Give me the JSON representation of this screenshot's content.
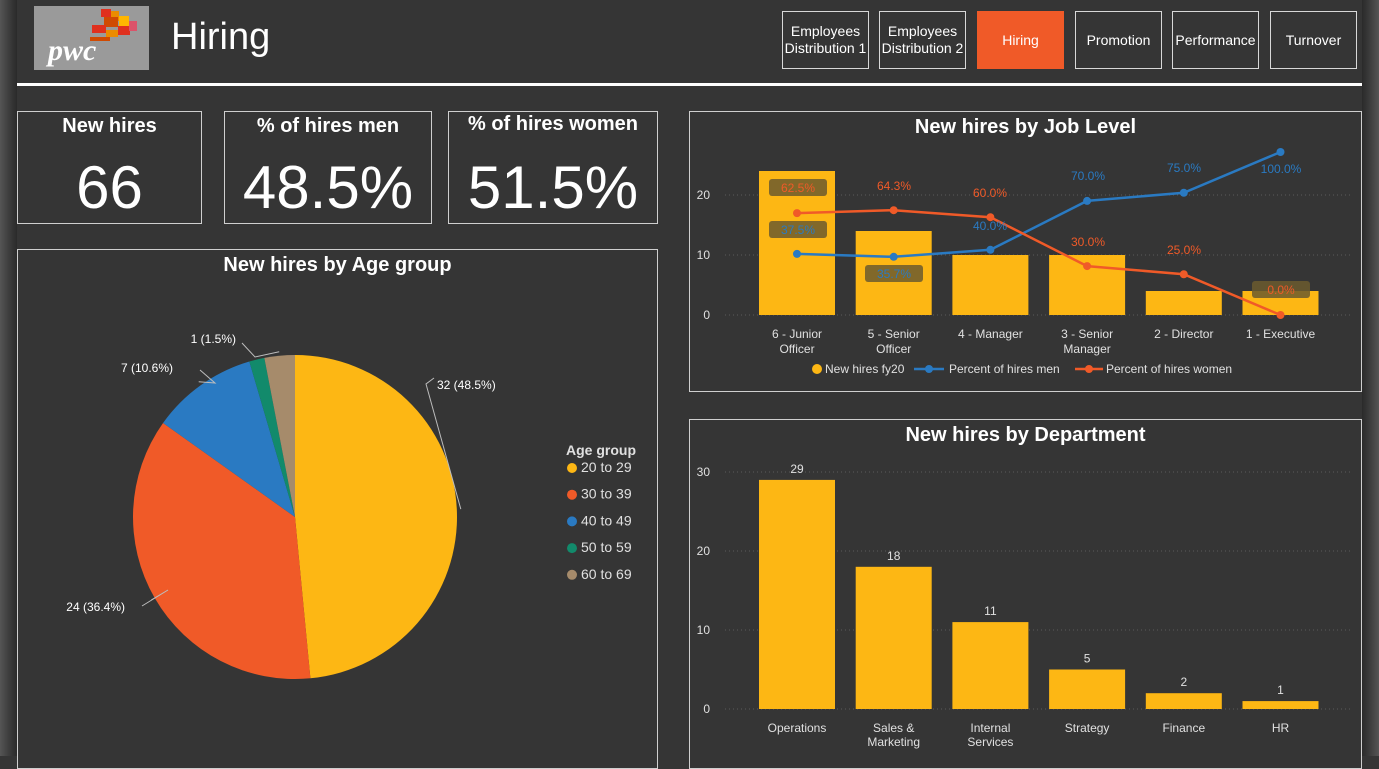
{
  "header": {
    "logo_text": "pwc",
    "title": "Hiring",
    "nav": [
      {
        "line1": "Employees",
        "line2": "Distribution 1",
        "active": false
      },
      {
        "line1": "Employees",
        "line2": "Distribution 2",
        "active": false
      },
      {
        "line1": "Hiring",
        "line2": "",
        "active": true
      },
      {
        "line1": "Promotion",
        "line2": "",
        "active": false
      },
      {
        "line1": "Performance",
        "line2": "",
        "active": false
      },
      {
        "line1": "Turnover",
        "line2": "",
        "active": false
      }
    ]
  },
  "kpis": {
    "new_hires": {
      "label": "New hires",
      "value": "66"
    },
    "men": {
      "label": "% of hires men",
      "value": "48.5%"
    },
    "women": {
      "label": "% of hires women",
      "value": "51.5%"
    }
  },
  "colors": {
    "yellow": "#fdb714",
    "orange": "#f05a28",
    "blue": "#2a7ac2",
    "teal": "#128a6b",
    "tan": "#a68b6b",
    "active_nav": "#f05a28"
  },
  "chart_data": [
    {
      "type": "pie",
      "title": "New hires by Age group",
      "legend_title": "Age group",
      "legend_position": "right",
      "slices": [
        {
          "label": "20 to 29",
          "value": 32,
          "data_label": "32 (48.5%)"
        },
        {
          "label": "30 to 39",
          "value": 24,
          "data_label": "24 (36.4%)"
        },
        {
          "label": "40 to 49",
          "value": 7,
          "data_label": "7 (10.6%)"
        },
        {
          "label": "50 to 59",
          "value": 1,
          "data_label": ""
        },
        {
          "label": "60 to 69",
          "value": 2,
          "data_label": "1 (1.5%)"
        }
      ]
    },
    {
      "type": "bar",
      "title": "New hires by Job Level",
      "categories": [
        "6 - Junior Officer",
        "5 - Senior Officer",
        "4 - Manager",
        "3 - Senior Manager",
        "2 - Director",
        "1 - Executive"
      ],
      "ylim": [
        0,
        27
      ],
      "yticks": [
        0,
        10,
        20
      ],
      "grid": true,
      "legend_position": "bottom",
      "series": [
        {
          "name": "New hires fy20",
          "kind": "bar",
          "values": [
            24,
            14,
            10,
            10,
            4,
            4
          ]
        },
        {
          "name": "Percent of hires men",
          "kind": "line",
          "axis": "secondary",
          "values": [
            37.5,
            35.7,
            40.0,
            70.0,
            75.0,
            100.0
          ],
          "labels": [
            "37.5%",
            "35.7%",
            "40.0%",
            "70.0%",
            "75.0%",
            "100.0%"
          ]
        },
        {
          "name": "Percent of hires women",
          "kind": "line",
          "axis": "secondary",
          "values": [
            62.5,
            64.3,
            60.0,
            30.0,
            25.0,
            0.0
          ],
          "labels": [
            "62.5%",
            "64.3%",
            "60.0%",
            "30.0%",
            "25.0%",
            "0.0%"
          ]
        }
      ]
    },
    {
      "type": "bar",
      "title": "New hires by Department",
      "categories": [
        "Operations",
        "Sales & Marketing",
        "Internal Services",
        "Strategy",
        "Finance",
        "HR"
      ],
      "values": [
        29,
        18,
        11,
        5,
        2,
        1
      ],
      "ylim": [
        0,
        32
      ],
      "yticks": [
        0,
        10,
        20,
        30
      ],
      "grid": true
    }
  ]
}
